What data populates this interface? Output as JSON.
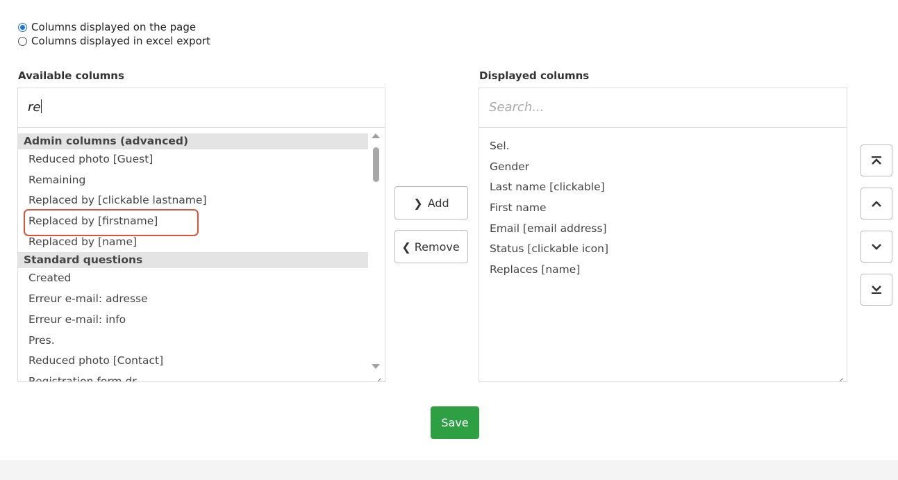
{
  "radio_options": [
    {
      "label": "Columns displayed on the page",
      "checked": true
    },
    {
      "label": "Columns displayed in excel export",
      "checked": false
    }
  ],
  "available": {
    "title": "Available columns",
    "search_value": "re",
    "groups": [
      {
        "name": "Admin columns (advanced)",
        "items": [
          "Reduced photo [Guest]",
          "Remaining",
          "Replaced by [clickable lastname]",
          "Replaced by [firstname]",
          "Replaced by [name]"
        ]
      },
      {
        "name": "Standard questions",
        "items": [
          "Created",
          "Erreur e-mail: adresse",
          "Erreur e-mail: info",
          "Pres.",
          "Reduced photo [Contact]",
          "Registration form dr..."
        ]
      }
    ]
  },
  "actions": {
    "add_label": "Add",
    "remove_label": "Remove"
  },
  "displayed": {
    "title": "Displayed columns",
    "search_placeholder": "Search...",
    "items": [
      "Sel.",
      "Gender",
      "Last name [clickable]",
      "First name",
      "Email [email address]",
      "Status [clickable icon]",
      "Replaces [name]"
    ]
  },
  "order_buttons": [
    "move-top",
    "move-up",
    "move-down",
    "move-bottom"
  ],
  "save_label": "Save",
  "colors": {
    "accent": "#1a73e8",
    "save_bg": "#2ea043",
    "highlight": "#d9533a"
  }
}
